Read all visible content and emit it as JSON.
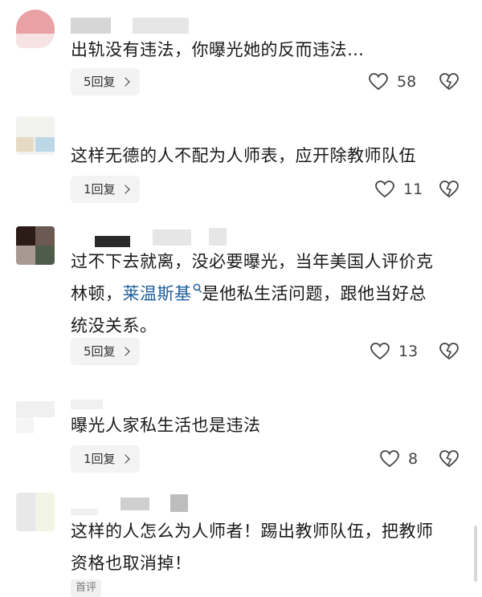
{
  "comments": [
    {
      "lines": [
        "出轨没有违法，你曝光她的反而违法…"
      ],
      "reply_label": "5回复",
      "like_count": "58"
    },
    {
      "lines": [
        "这样无德的人不配为人师表，应开除教师队伍"
      ],
      "reply_label": "1回复",
      "like_count": "11"
    },
    {
      "line1": "过不下去就离，没必要曝光，当年美国人评价克",
      "line2_pre": "林顿，",
      "line2_link": "莱温斯基",
      "line2_post": "是他私生活问题，跟他当好总",
      "line3": "统没关系。",
      "reply_label": "5回复",
      "like_count": "13"
    },
    {
      "lines": [
        "曝光人家私生活也是违法"
      ],
      "reply_label": "1回复",
      "like_count": "8"
    },
    {
      "lines": [
        "这样的人怎么为人师者！踢出教师队伍，把教师",
        "资格也取消掉！"
      ],
      "tag": "首评"
    }
  ],
  "colors": {
    "link": "#1f5f9e",
    "button_bg": "#f3f3f3",
    "icon": "#444444"
  },
  "icons": [
    "heart-icon",
    "dislike-heart-icon",
    "search-icon",
    "chevron-right-icon"
  ]
}
